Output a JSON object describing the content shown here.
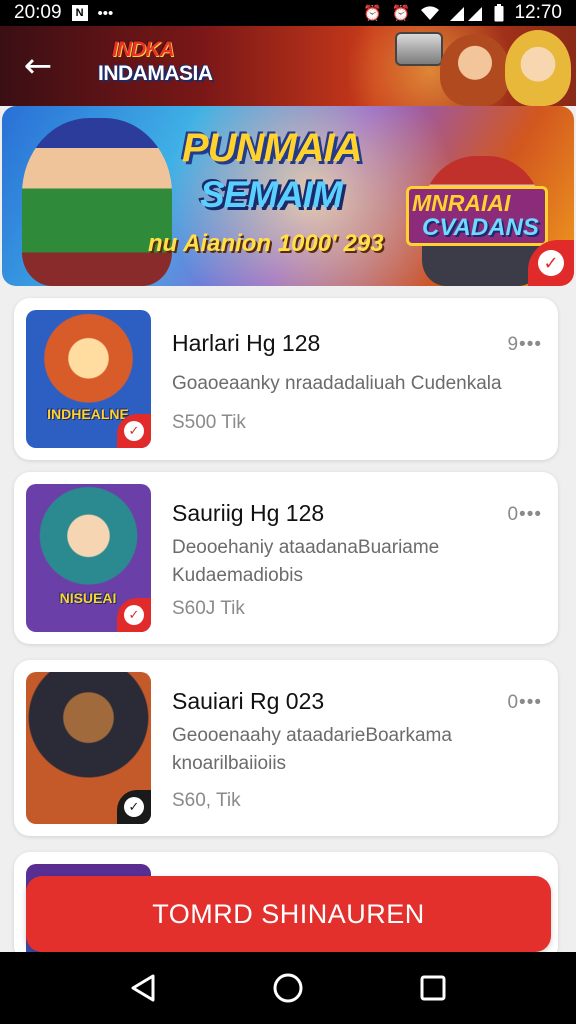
{
  "status_bar": {
    "time_left": "20:09",
    "time_right": "12:70",
    "icons": [
      "notification-icon",
      "more-dots-icon",
      "alarm-icon",
      "wifi-icon",
      "signal-icon",
      "battery-icon"
    ]
  },
  "header": {
    "logo_top": "INDKA",
    "logo_bottom": "INDAMASIA",
    "back_icon": "arrow-left-icon"
  },
  "banner": {
    "title_line1": "PUNMAIA",
    "title_line2": "SEMAIM",
    "subtitle": "nu Aianion 1000' 293",
    "badge_line1": "MNRAIAI",
    "badge_line2": "CVADANS",
    "check_icon": "checkmark-icon"
  },
  "items": [
    {
      "title": "Harlari Hg 128",
      "description": "Goaoeaanky nraadadaliuah Cudenkala",
      "price": "S500 Tik",
      "menu": "9•••",
      "thumb_caption": "INDHEALNE"
    },
    {
      "title": "Sauriig Hg 128",
      "description": "Deooehaniy ataadanaBuariame Kudaemadiobis",
      "price": "S60J Tik",
      "menu": "0•••",
      "thumb_caption": "NISUEAI"
    },
    {
      "title": "Sauiari Rg 023",
      "description": "Geooenaahy ataadarieBoarkama knoarilbaiioiis",
      "price": "S60, Tik",
      "menu": "0•••",
      "thumb_caption": ""
    },
    {
      "title": "",
      "description": "",
      "price": "",
      "menu": "",
      "thumb_caption": ""
    }
  ],
  "cta": {
    "label": "TOMRD SHINAUREN"
  },
  "nav_bar": {
    "back": "back-triangle-icon",
    "home": "home-circle-icon",
    "recents": "recents-square-icon"
  },
  "colors": {
    "accent_red": "#e3302d",
    "header_red": "#7a1717",
    "card_bg": "#ffffff",
    "page_bg": "#efefef"
  }
}
